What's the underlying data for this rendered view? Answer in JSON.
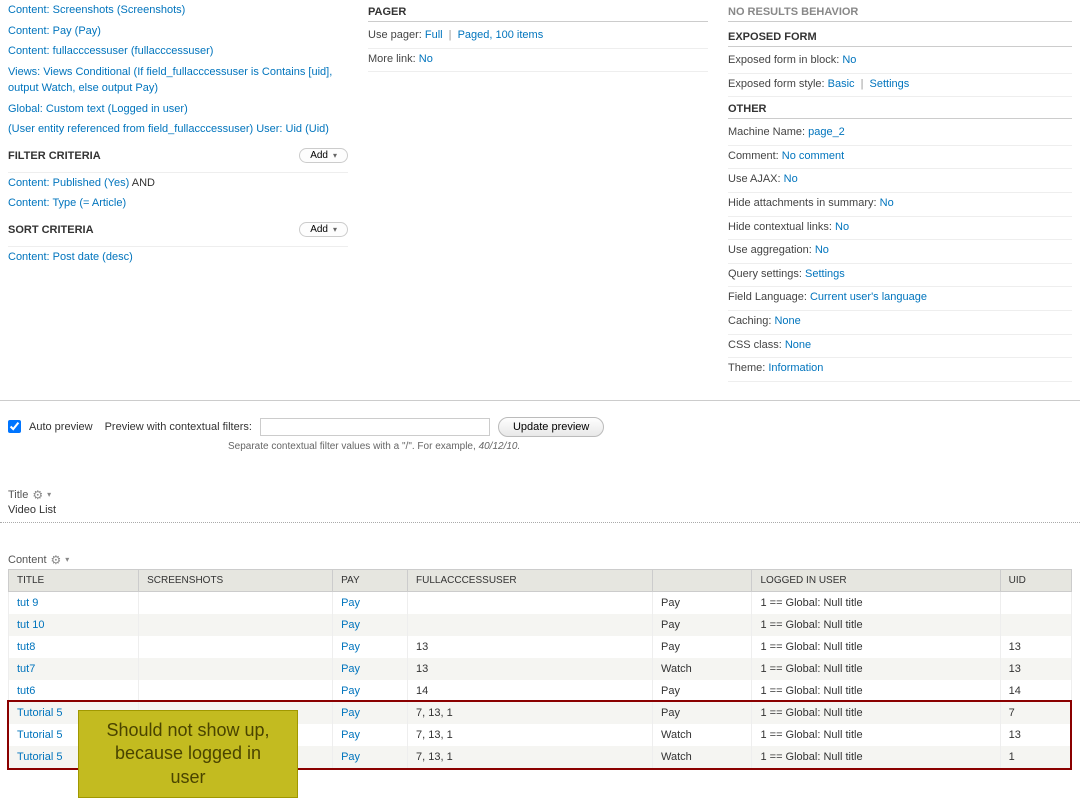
{
  "fields": [
    "Content: Screenshots (Screenshots)",
    "Content: Pay (Pay)",
    "Content: fullacccessuser (fullacccessuser)",
    "Views: Views Conditional (If field_fullacccessuser is Contains [uid], output Watch, else output Pay)",
    "Global: Custom text (Logged in user)",
    "(User entity referenced from field_fullacccessuser) User: Uid (Uid)"
  ],
  "filter": {
    "title": "FILTER CRITERIA",
    "add": "Add",
    "items": [
      {
        "text": "Content: Published (Yes)",
        "suffix": "AND"
      },
      {
        "text": "Content: Type (= Article)",
        "suffix": ""
      }
    ]
  },
  "sort": {
    "title": "SORT CRITERIA",
    "add": "Add",
    "items": [
      {
        "text": "Content: Post date (desc)"
      }
    ]
  },
  "pager": {
    "title": "PAGER",
    "rows": [
      {
        "label": "Use pager:",
        "links": [
          "Full",
          "Paged, 100 items"
        ],
        "sep": "|"
      },
      {
        "label": "More link:",
        "links": [
          "No"
        ]
      }
    ]
  },
  "behavior_title": "NO RESULTS BEHAVIOR",
  "exposed": {
    "title": "EXPOSED FORM",
    "rows": [
      {
        "label": "Exposed form in block:",
        "links": [
          "No"
        ]
      },
      {
        "label": "Exposed form style:",
        "links": [
          "Basic",
          "Settings"
        ],
        "sep": "|"
      }
    ]
  },
  "other": {
    "title": "OTHER",
    "rows": [
      {
        "label": "Machine Name:",
        "links": [
          "page_2"
        ]
      },
      {
        "label": "Comment:",
        "links": [
          "No comment"
        ]
      },
      {
        "label": "Use AJAX:",
        "links": [
          "No"
        ]
      },
      {
        "label": "Hide attachments in summary:",
        "links": [
          "No"
        ]
      },
      {
        "label": "Hide contextual links:",
        "links": [
          "No"
        ]
      },
      {
        "label": "Use aggregation:",
        "links": [
          "No"
        ]
      },
      {
        "label": "Query settings:",
        "links": [
          "Settings"
        ]
      },
      {
        "label": "Field Language:",
        "links": [
          "Current user's language"
        ]
      },
      {
        "label": "Caching:",
        "links": [
          "None"
        ]
      },
      {
        "label": "CSS class:",
        "links": [
          "None"
        ]
      },
      {
        "label": "Theme:",
        "links": [
          "Information"
        ]
      }
    ]
  },
  "preview": {
    "auto": "Auto preview",
    "label": "Preview with contextual filters:",
    "button": "Update preview",
    "hint_prefix": "Separate contextual filter values with a \"/\". For example, ",
    "hint_em": "40/12/10."
  },
  "title_section": "Title",
  "view_title": "Video List",
  "content_section": "Content",
  "columns": [
    "TITLE",
    "SCREENSHOTS",
    "PAY",
    "FULLACCCESSUSER",
    "",
    "LOGGED IN USER",
    "UID"
  ],
  "rows": [
    {
      "title": "tut 9",
      "pay": "Pay",
      "full": "",
      "watch": "Pay",
      "logged": "1 == Global: Null title",
      "uid": ""
    },
    {
      "title": "tut 10",
      "pay": "Pay",
      "full": "",
      "watch": "Pay",
      "logged": "1 == Global: Null title",
      "uid": ""
    },
    {
      "title": "tut8",
      "pay": "Pay",
      "full": "13",
      "watch": "Pay",
      "logged": "1 == Global: Null title",
      "uid": "13"
    },
    {
      "title": "tut7",
      "pay": "Pay",
      "full": "13",
      "watch": "Watch",
      "logged": "1 == Global: Null title",
      "uid": "13"
    },
    {
      "title": "tut6",
      "pay": "Pay",
      "full": "14",
      "watch": "Pay",
      "logged": "1 == Global: Null title",
      "uid": "14"
    },
    {
      "title": "Tutorial 5",
      "pay": "Pay",
      "full": "7, 13, 1",
      "watch": "Pay",
      "logged": "1 == Global: Null title",
      "uid": "7"
    },
    {
      "title": "Tutorial 5",
      "pay": "Pay",
      "full": "7, 13, 1",
      "watch": "Watch",
      "logged": "1 == Global: Null title",
      "uid": "13"
    },
    {
      "title": "Tutorial 5",
      "pay": "Pay",
      "full": "7, 13, 1",
      "watch": "Watch",
      "logged": "1 == Global: Null title",
      "uid": "1"
    }
  ],
  "annotation": "Should not show up,\nbecause logged in user"
}
